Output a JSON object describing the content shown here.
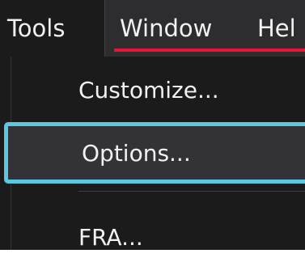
{
  "menubar": {
    "items": [
      {
        "label": "Tools"
      },
      {
        "label": "Window"
      },
      {
        "label": "Hel"
      }
    ]
  },
  "dropdown": {
    "items": [
      {
        "label": "Customize..."
      },
      {
        "label": "Options..."
      },
      {
        "label": "FRA..."
      }
    ]
  },
  "colors": {
    "menubar_bg": "#2d2d30",
    "dropdown_bg": "#1b1b1c",
    "highlight_border": "#5bc8e0",
    "accent_underline": "#e8153a"
  }
}
